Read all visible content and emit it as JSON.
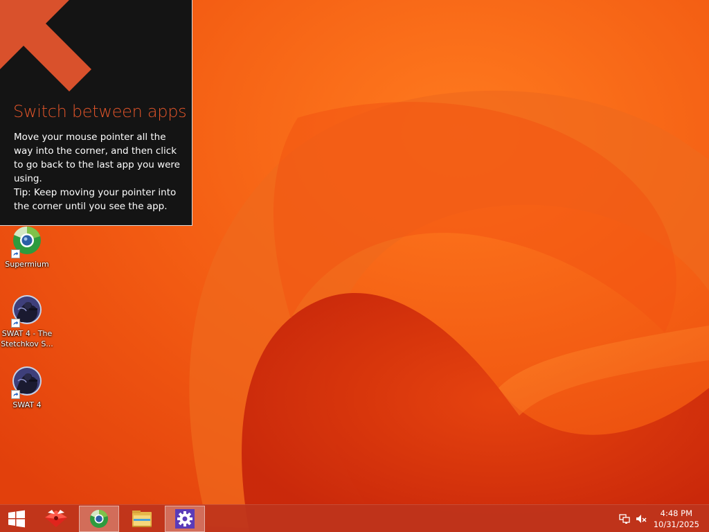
{
  "tip": {
    "title": "Switch between apps",
    "body": "Move your mouse pointer all the way into the corner, and then click to go back to the last app you were using.",
    "tip": "Tip: Keep moving your pointer into the corner until you see the app.",
    "arrow_color": "#d9512c"
  },
  "desktop_icons": [
    {
      "label": "Supermium",
      "icon": "supermium-icon"
    },
    {
      "label": "SWAT 4 - The Stetchkov S...",
      "icon": "swat4-icon"
    },
    {
      "label": "SWAT 4",
      "icon": "swat4-icon"
    }
  ],
  "taskbar": {
    "items": [
      {
        "name": "start-button",
        "icon": "windows-logo-icon"
      },
      {
        "name": "taskbar-app-red",
        "icon": "red-app-icon"
      },
      {
        "name": "taskbar-supermium",
        "icon": "supermium-icon",
        "active": true
      },
      {
        "name": "taskbar-file-explorer",
        "icon": "folder-icon"
      },
      {
        "name": "taskbar-settings",
        "icon": "gear-icon",
        "active": true
      }
    ],
    "tray": {
      "network_icon": "network-icon",
      "volume_icon": "volume-muted-icon",
      "time": "4:48 PM",
      "date": "10/31/2025"
    }
  },
  "colors": {
    "wallpaper_base": "#f05a12",
    "wallpaper_dark": "#d42a0c",
    "taskbar": "#be341c",
    "tip_background": "#141414",
    "tip_title": "#e2552a"
  }
}
